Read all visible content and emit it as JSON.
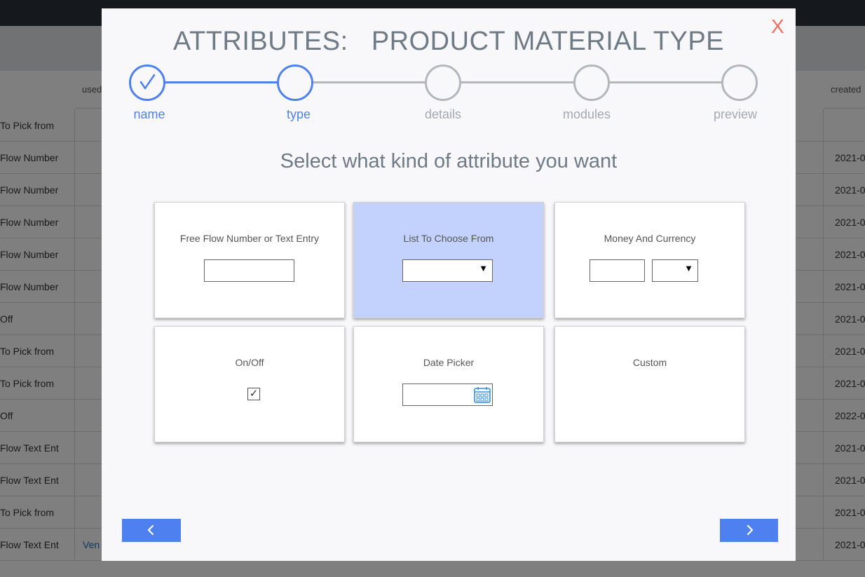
{
  "background": {
    "columns": [
      {
        "label": "used"
      },
      {
        "label": "created"
      }
    ],
    "rows": [
      {
        "type": "To Pick from",
        "used": "",
        "date": ""
      },
      {
        "type": "Flow Number",
        "used": "",
        "date": "2021-0"
      },
      {
        "type": "Flow Number",
        "used": "",
        "date": "2021-0"
      },
      {
        "type": "Flow Number",
        "used": "",
        "date": "2021-0"
      },
      {
        "type": "Flow Number",
        "used": "",
        "date": "2021-0"
      },
      {
        "type": "Flow Number",
        "used": "",
        "date": "2021-0"
      },
      {
        "type": "Off",
        "used": "",
        "date": "2021-0"
      },
      {
        "type": "To Pick from",
        "used": "",
        "date": "2021-0"
      },
      {
        "type": "To Pick from",
        "used": "",
        "date": "2021-0"
      },
      {
        "type": "Off",
        "used": "",
        "date": "2022-0"
      },
      {
        "type": "Flow Text Ent",
        "used": "",
        "date": "2021-0"
      },
      {
        "type": "Flow Text Ent",
        "used": "",
        "date": "2021-0"
      },
      {
        "type": "To Pick from",
        "used": "",
        "date": "2021-0"
      },
      {
        "type": "Flow Text Ent",
        "used": "Ven",
        "date": "2021-0"
      }
    ]
  },
  "modal": {
    "title": "ATTRIBUTES:   PRODUCT MATERIAL TYPE",
    "close_label": "X",
    "subtitle": "Select what kind of attribute you want",
    "steps": [
      {
        "label": "name",
        "state": "done"
      },
      {
        "label": "type",
        "state": "current"
      },
      {
        "label": "details",
        "state": "todo"
      },
      {
        "label": "modules",
        "state": "todo"
      },
      {
        "label": "preview",
        "state": "todo"
      }
    ],
    "options": [
      {
        "label": "Free Flow Number or Text Entry",
        "selected": false
      },
      {
        "label": "List To Choose From",
        "selected": true
      },
      {
        "label": "Money And Currency",
        "selected": false
      },
      {
        "label": "On/Off",
        "selected": false
      },
      {
        "label": "Date Picker",
        "selected": false
      },
      {
        "label": "Custom",
        "selected": false
      }
    ],
    "back_icon": "chevron-left-icon",
    "next_icon": "chevron-right-icon"
  },
  "colors": {
    "accent": "#4f80f0",
    "selected_card": "#c2d2fc",
    "close": "#f26d60",
    "title": "#6e7a86"
  }
}
